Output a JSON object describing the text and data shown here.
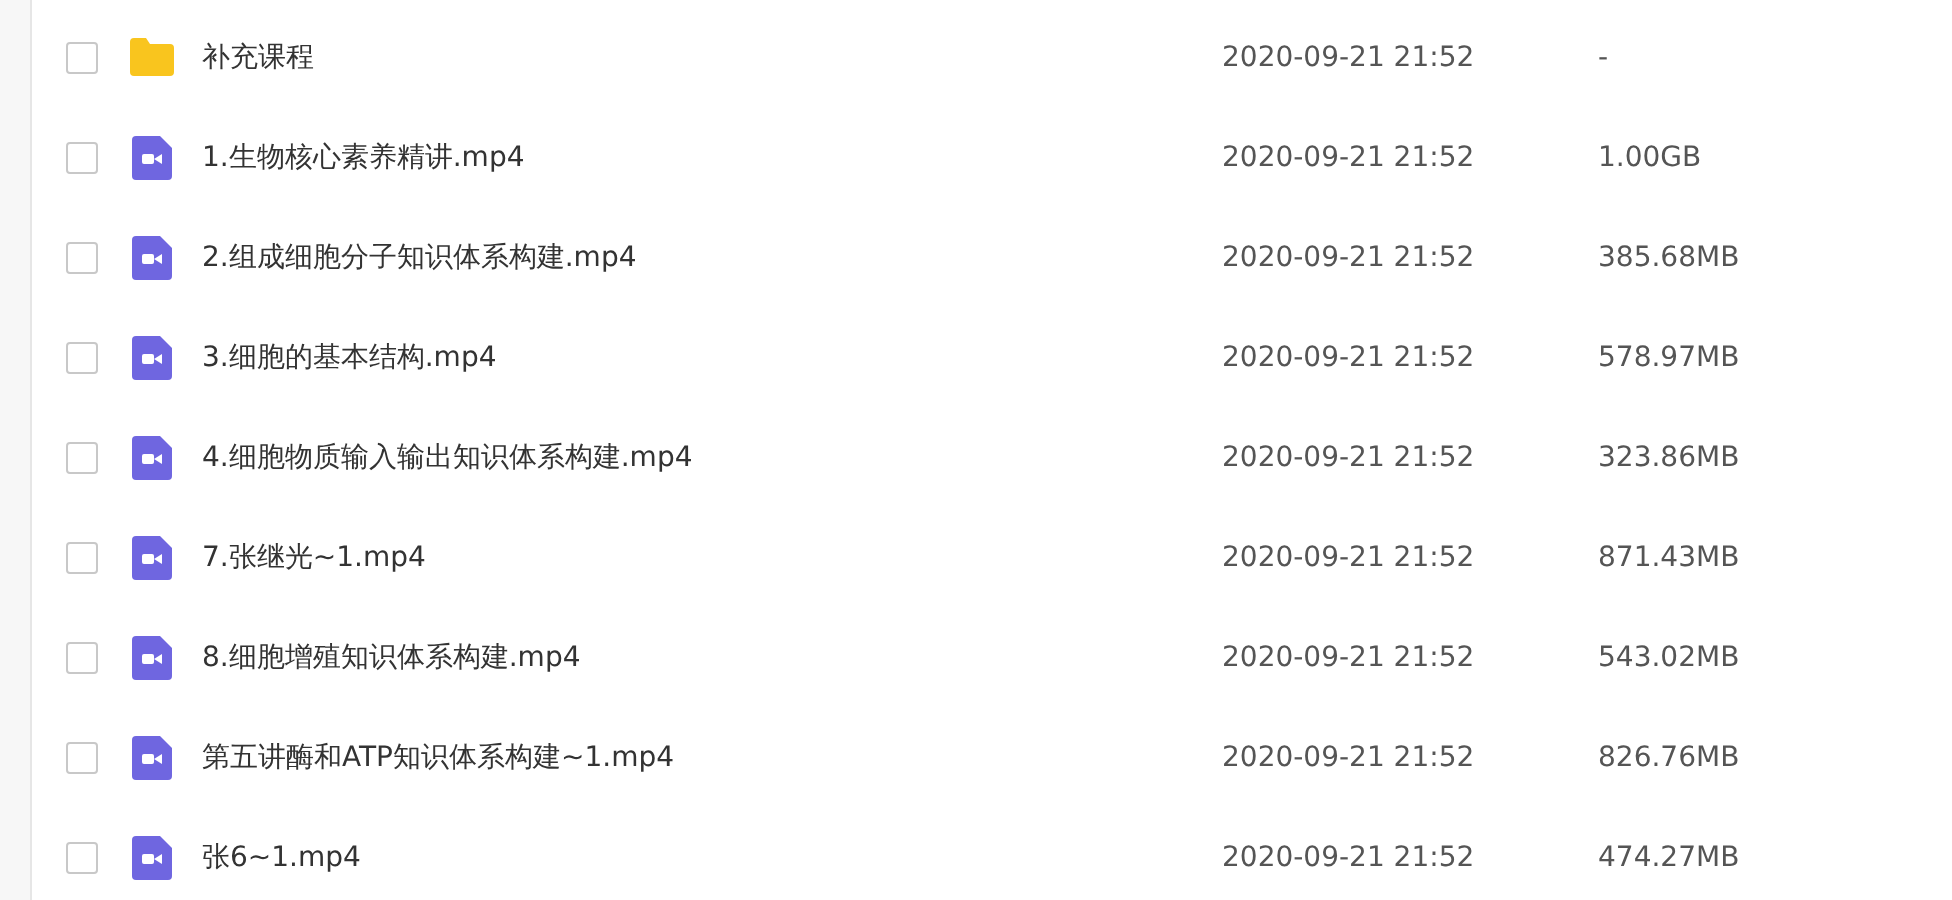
{
  "files": [
    {
      "kind": "folder",
      "name": "补充课程",
      "modified": "2020-09-21 21:52",
      "size": "-",
      "checked": false
    },
    {
      "kind": "video",
      "name": "1.生物核心素养精讲.mp4",
      "modified": "2020-09-21 21:52",
      "size": "1.00GB",
      "checked": false
    },
    {
      "kind": "video",
      "name": "2.组成细胞分子知识体系构建.mp4",
      "modified": "2020-09-21 21:52",
      "size": "385.68MB",
      "checked": false
    },
    {
      "kind": "video",
      "name": "3.细胞的基本结构.mp4",
      "modified": "2020-09-21 21:52",
      "size": "578.97MB",
      "checked": false
    },
    {
      "kind": "video",
      "name": "4.细胞物质输入输出知识体系构建.mp4",
      "modified": "2020-09-21 21:52",
      "size": "323.86MB",
      "checked": false
    },
    {
      "kind": "video",
      "name": "7.张继光~1.mp4",
      "modified": "2020-09-21 21:52",
      "size": "871.43MB",
      "checked": false
    },
    {
      "kind": "video",
      "name": "8.细胞增殖知识体系构建.mp4",
      "modified": "2020-09-21 21:52",
      "size": "543.02MB",
      "checked": false
    },
    {
      "kind": "video",
      "name": "第五讲酶和ATP知识体系构建~1.mp4",
      "modified": "2020-09-21 21:52",
      "size": "826.76MB",
      "checked": false
    },
    {
      "kind": "video",
      "name": "张6~1.mp4",
      "modified": "2020-09-21 21:52",
      "size": "474.27MB",
      "checked": false
    }
  ]
}
